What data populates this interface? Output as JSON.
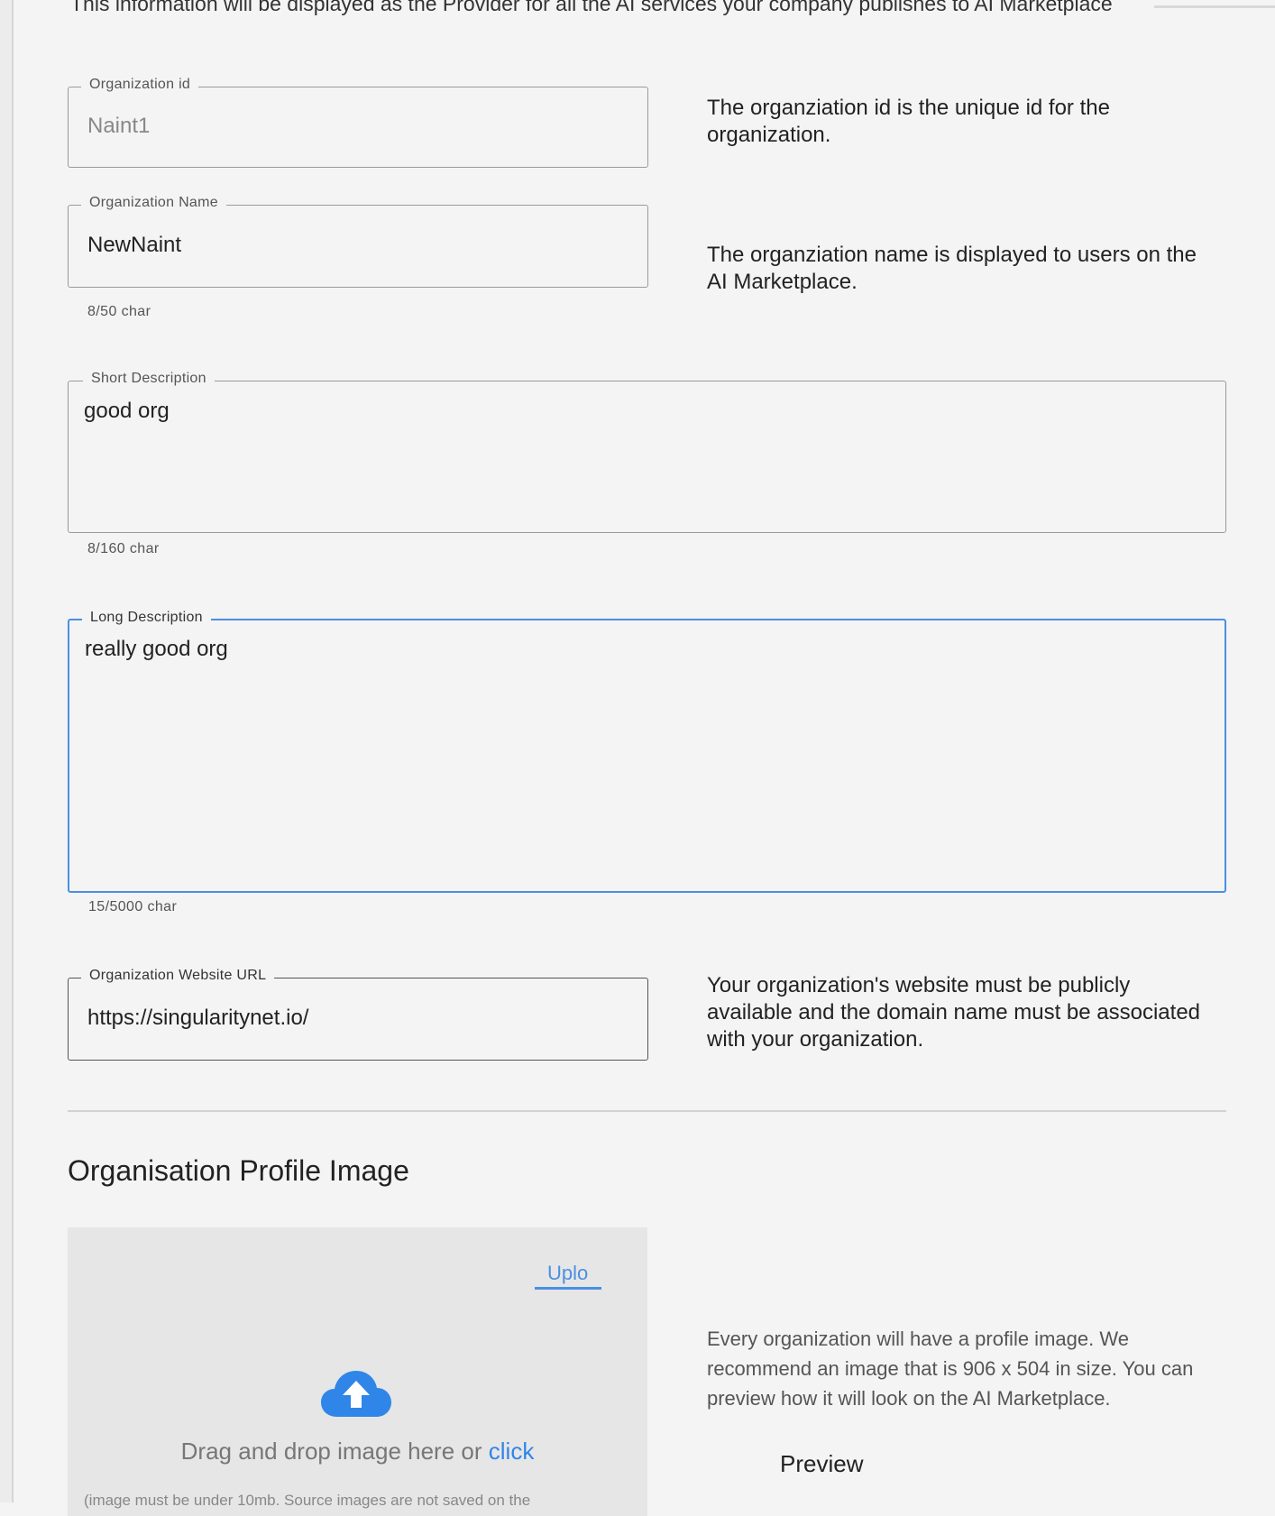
{
  "intro_text": "This information will be displayed as the Provider for all the AI services your company publishes to AI Marketplace",
  "org_id": {
    "label": "Organization id",
    "value": "Naint1",
    "help": "The organziation id is the unique id for the organization."
  },
  "org_name": {
    "label": "Organization Name",
    "value": "NewNaint",
    "counter": "8/50 char",
    "help": "The organziation name is displayed to users on the AI Marketplace."
  },
  "short_description": {
    "label": "Short Description",
    "value": "good org",
    "counter": "8/160 char"
  },
  "long_description": {
    "label": "Long Description",
    "value": "really good org",
    "counter": "15/5000 char"
  },
  "website": {
    "label": "Organization Website URL",
    "value": "https://singularitynet.io/",
    "help": "Your organization's website must be publicly available and the domain name must be associated with your organization."
  },
  "profile_image": {
    "section_title": "Organisation Profile Image",
    "upload_tab": "Uplo",
    "drop_text": "Drag and drop image here or",
    "drop_link": "click",
    "drop_note": "(image must be under 10mb. Source images are not saved on the",
    "help": "Every organization will have a profile image. We recommend an image that is 906 x 504 in size. You can preview how it will look on the AI Marketplace.",
    "preview_label": "Preview"
  },
  "colors": {
    "accent": "#4a90e2",
    "upload_icon": "#2f86e8"
  },
  "icons": {
    "upload": "cloud-upload-icon"
  }
}
